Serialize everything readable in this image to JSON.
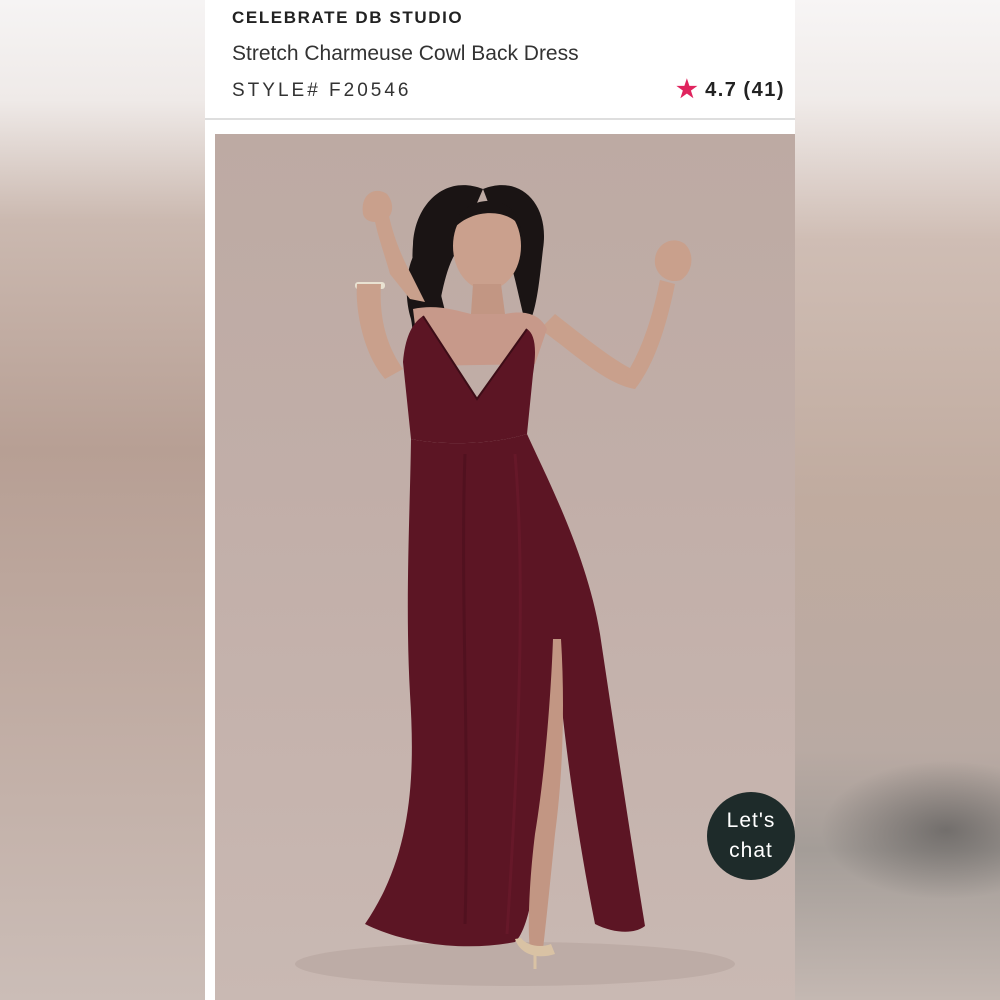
{
  "product": {
    "brand": "CELEBRATE DB STUDIO",
    "name": "Stretch Charmeuse Cowl Back Dress",
    "style": "STYLE# F20546",
    "rating": "4.7",
    "review_count": "(41)",
    "rating_icon": "star-icon"
  },
  "chat": {
    "line1": "Let's",
    "line2": "chat"
  },
  "colors": {
    "accent_star": "#e0245e",
    "chat_bg": "#1e2b2a",
    "dress": "#5c1524"
  }
}
